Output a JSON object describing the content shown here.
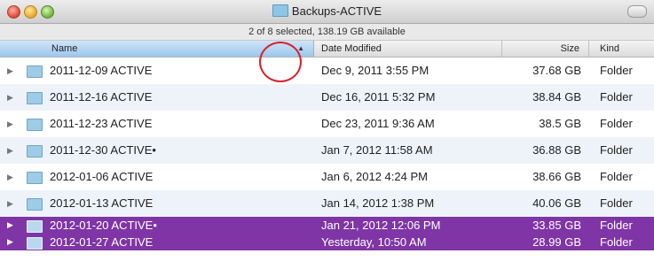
{
  "window": {
    "title": "Backups-ACTIVE"
  },
  "status": {
    "text": "2 of 8 selected, 138.19 GB available"
  },
  "columns": {
    "name": "Name",
    "date": "Date Modified",
    "size": "Size",
    "kind": "Kind",
    "sort_indicator": "▲"
  },
  "rows": [
    {
      "name": "2011-12-09 ACTIVE",
      "date": "Dec 9, 2011 3:55 PM",
      "size": "37.68 GB",
      "kind": "Folder",
      "selected": false
    },
    {
      "name": "2011-12-16 ACTIVE",
      "date": "Dec 16, 2011 5:32 PM",
      "size": "38.84 GB",
      "kind": "Folder",
      "selected": false
    },
    {
      "name": "2011-12-23 ACTIVE",
      "date": "Dec 23, 2011 9:36 AM",
      "size": "38.5 GB",
      "kind": "Folder",
      "selected": false
    },
    {
      "name": "2011-12-30 ACTIVE•",
      "date": "Jan 7, 2012 11:58 AM",
      "size": "36.88 GB",
      "kind": "Folder",
      "selected": false
    },
    {
      "name": "2012-01-06 ACTIVE",
      "date": "Jan 6, 2012 4:24 PM",
      "size": "38.66 GB",
      "kind": "Folder",
      "selected": false
    },
    {
      "name": "2012-01-13 ACTIVE",
      "date": "Jan 14, 2012 1:38 PM",
      "size": "40.06 GB",
      "kind": "Folder",
      "selected": false
    },
    {
      "name": "2012-01-20 ACTIVE•",
      "date": "Jan 21, 2012 12:06 PM",
      "size": "33.85 GB",
      "kind": "Folder",
      "selected": true
    },
    {
      "name": "2012-01-27 ACTIVE",
      "date": "Yesterday, 10:50 AM",
      "size": "28.99 GB",
      "kind": "Folder",
      "selected": true
    }
  ],
  "colors": {
    "selection": "#7f35a5",
    "annotation_circle": "#d8222a"
  },
  "icons": {
    "row_disclosure": "disclosure-triangle-icon",
    "row_folder": "folder-icon"
  }
}
